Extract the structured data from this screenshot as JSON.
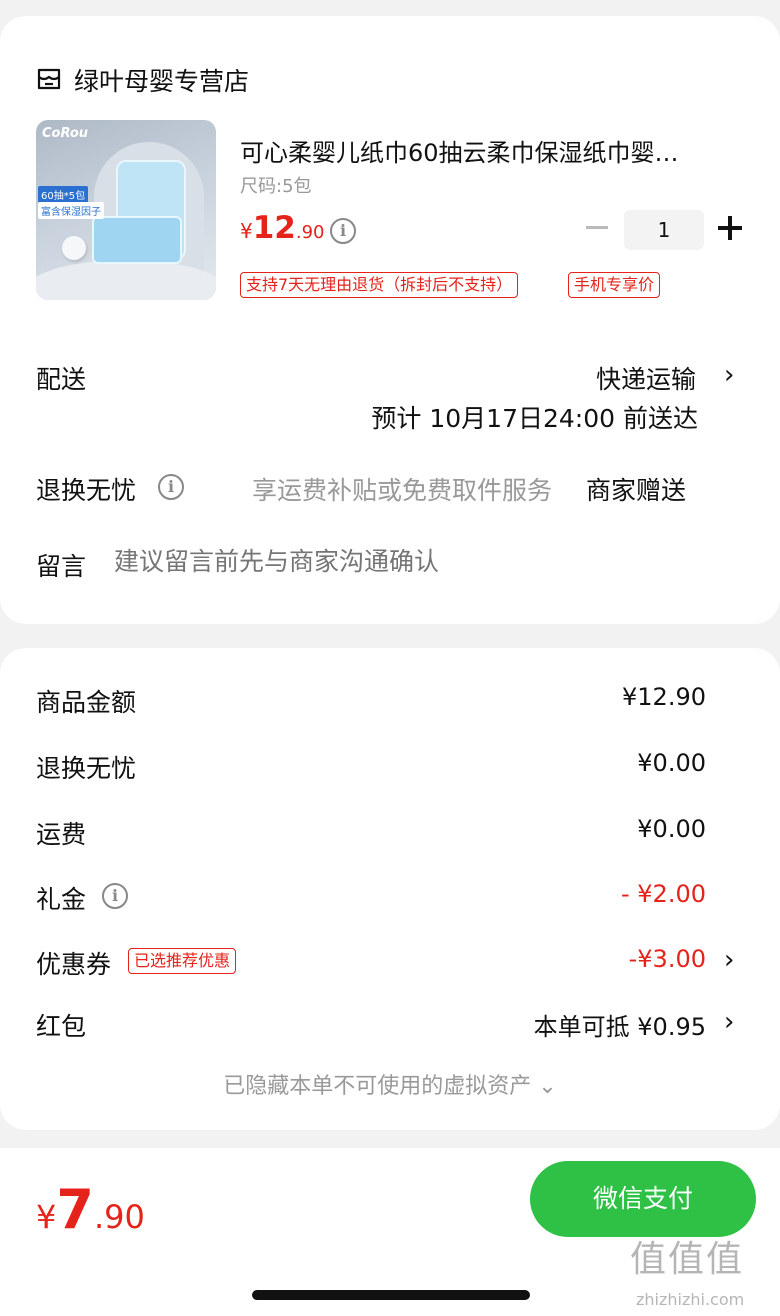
{
  "store": {
    "name": "绿叶母婴专营店"
  },
  "product": {
    "image_text": {
      "brand": "CoRou",
      "tag1": "60抽*5包",
      "tag2": "富含保湿因子"
    },
    "title": "可心柔婴儿纸巾60抽云柔巾保湿纸巾婴…",
    "spec": "尺码:5包",
    "price": {
      "symbol": "¥",
      "integer": "12",
      "decimal": ".90"
    },
    "quantity": "1",
    "tags": [
      "支持7天无理由退货（拆封后不支持）",
      "手机专享价"
    ]
  },
  "delivery": {
    "label": "配送",
    "method": "快递运输",
    "eta": "预计 10月17日24:00 前送达"
  },
  "return_service": {
    "label": "退换无忧",
    "desc": "享运费补贴或免费取件服务",
    "gift": "商家赠送"
  },
  "message": {
    "label": "留言",
    "placeholder": "建议留言前先与商家沟通确认"
  },
  "summary": {
    "goods_label": "商品金额",
    "goods_value": "¥12.90",
    "return_label": "退换无忧",
    "return_value": "¥0.00",
    "shipping_label": "运费",
    "shipping_value": "¥0.00",
    "gift_label": "礼金",
    "gift_value": "- ¥2.00",
    "coupon_label": "优惠券",
    "coupon_tag": "已选推荐优惠",
    "coupon_value": "-¥3.00",
    "redpacket_label": "红包",
    "redpacket_value": "本单可抵 ¥0.95",
    "hidden_assets": "已隐藏本单不可使用的虚拟资产 ⌄"
  },
  "footer": {
    "total": {
      "symbol": "¥",
      "integer": "7",
      "decimal": ".90"
    },
    "pay_label": "微信支付",
    "watermark": "值值值",
    "watermark_url": "zhizhizhi.com"
  },
  "colors": {
    "accent_red": "#e5231b",
    "pay_green": "#2ec146"
  },
  "icons": {
    "store": "store-icon",
    "info": "info-icon",
    "chevron": "chevron-right-icon"
  }
}
